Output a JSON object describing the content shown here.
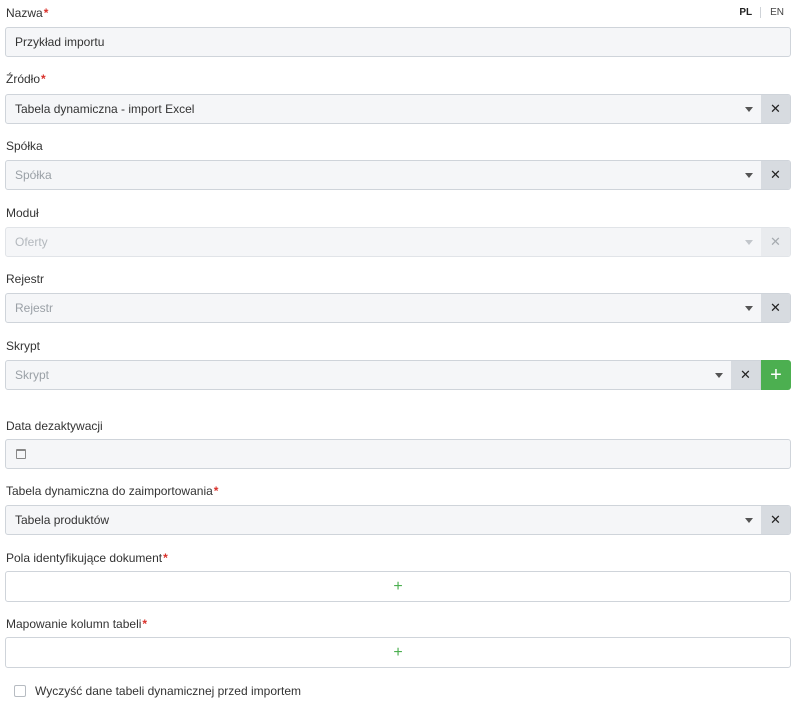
{
  "language": {
    "active": "PL",
    "other": "EN"
  },
  "name": {
    "label": "Nazwa",
    "required": "*",
    "value": "Przykład importu"
  },
  "source": {
    "label": "Źródło",
    "required": "*",
    "value": "Tabela dynamiczna - import Excel",
    "clear": "✕"
  },
  "company": {
    "label": "Spółka",
    "placeholder": "Spółka",
    "clear": "✕"
  },
  "module": {
    "label": "Moduł",
    "placeholder": "Oferty",
    "clear": "✕",
    "disabled": true
  },
  "register": {
    "label": "Rejestr",
    "placeholder": "Rejestr",
    "clear": "✕"
  },
  "script": {
    "label": "Skrypt",
    "placeholder": "Skrypt",
    "clear": "✕",
    "add": "+"
  },
  "deactivation_date": {
    "label": "Data dezaktywacji"
  },
  "dynamic_table": {
    "label": "Tabela dynamiczna do zaimportowania",
    "required": "*",
    "value": "Tabela produktów",
    "clear": "✕"
  },
  "identifying_fields": {
    "label": "Pola identyfikujące dokument",
    "required": "*",
    "add": "+"
  },
  "column_mapping": {
    "label": "Mapowanie kolumn tabeli",
    "required": "*",
    "add": "+"
  },
  "clear_before_import": {
    "label": "Wyczyść dane tabeli dynamicznej przed importem",
    "checked": false
  },
  "colors": {
    "accent_green": "#4caf50",
    "required_red": "#d9312b",
    "clear_bg": "#d7dbe0"
  }
}
